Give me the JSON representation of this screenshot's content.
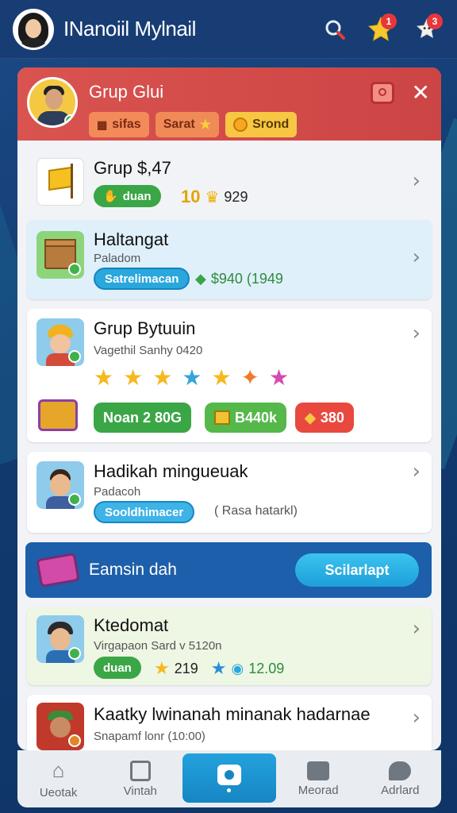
{
  "app": {
    "title": "INanoiil Mylnail"
  },
  "topbar": {
    "notification_badge": "",
    "star_badge": "1",
    "bell_badge": "3"
  },
  "header": {
    "title": "Grup Glui",
    "chips": [
      "sifas",
      "Sarat",
      "Srond"
    ]
  },
  "items": [
    {
      "title": "Grup $,47",
      "pill": "duan",
      "meta": "929",
      "meta_prefix": "10"
    },
    {
      "title": "Haltangat",
      "subtitle": "Paladom",
      "pill": "Satrelimacan",
      "meta": "$940 (1949"
    },
    {
      "title": "Grup Bytuuin",
      "subtitle": "Vagethil Sanhy 0420",
      "buttons": [
        "Noan 2 80G",
        "B440k",
        "380"
      ]
    },
    {
      "title": "Hadikah mingueuak",
      "subtitle": "Padacoh",
      "pill": "Sooldhimacer",
      "meta": "( Rasa hatarkl)"
    },
    {
      "title": "Ktedomat",
      "subtitle": "Virgapaon Sard v 5120n",
      "pill": "duan",
      "meta_a": "219",
      "meta_b": "12.09"
    },
    {
      "title": "Kaatky lwinanah minanak hadarnae",
      "subtitle": "Snapamf lonr (10:00)"
    }
  ],
  "promo": {
    "text": "Eamsin dah",
    "button": "Scilarlapt"
  },
  "bottom_nav": [
    "Ueotak",
    "Vintah",
    "",
    "Meorad",
    "Adrlard"
  ],
  "colors": {
    "header_red": "#d9534f",
    "accent_blue": "#23a2dd",
    "topbar": "#173d74"
  }
}
